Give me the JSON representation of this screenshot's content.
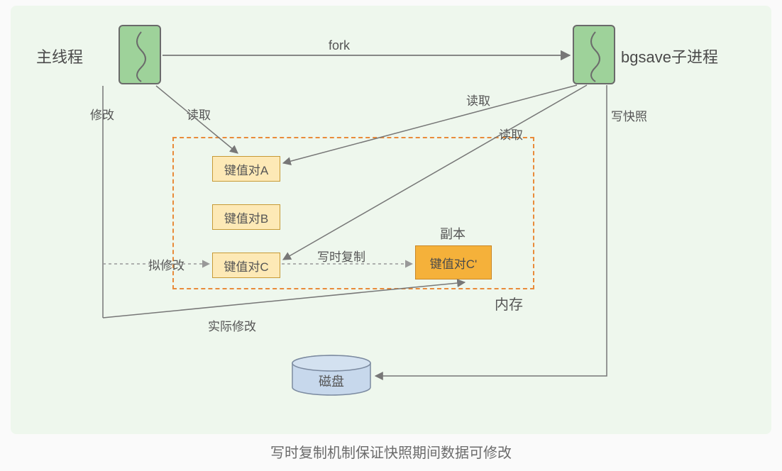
{
  "caption": "写时复制机制保证快照期间数据可修改",
  "nodes": {
    "main_thread": "主线程",
    "bgsave_proc": "bgsave子进程",
    "kv_a": "键值对A",
    "kv_b": "键值对B",
    "kv_c": "键值对C",
    "kv_c_copy": "键值对C'",
    "copy_title": "副本",
    "memory_label": "内存",
    "disk": "磁盘"
  },
  "edges": {
    "fork": "fork",
    "main_read": "读取",
    "main_modify": "修改",
    "plan_modify": "拟修改",
    "cow": "写时复制",
    "actual_modify": "实际修改",
    "bg_read1": "读取",
    "bg_read2": "读取",
    "snapshot": "写快照"
  }
}
